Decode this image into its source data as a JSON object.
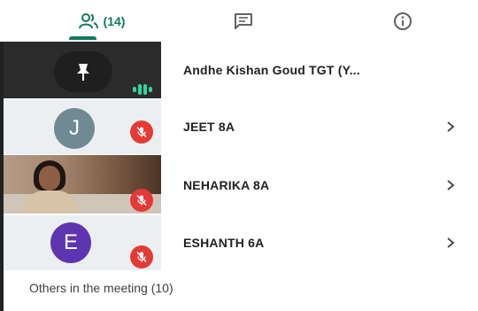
{
  "tabs": {
    "people": {
      "icon": "people-icon",
      "count": "(14)",
      "active": true
    },
    "chat": {
      "icon": "chat-icon"
    },
    "info": {
      "icon": "info-icon"
    }
  },
  "accent_color": "#0f7a5f",
  "participants": [
    {
      "name": "Andhe Kishan Goud TGT (Y...",
      "avatar_icon": "pin-icon",
      "status_icon": "speaking-indicator-icon",
      "avatar_color": "#1f1f1f"
    },
    {
      "name": "JEET 8A",
      "avatar_letter": "J",
      "status_icon": "mic-off-icon",
      "avatar_color": "#6f8a92"
    },
    {
      "name": "NEHARIKA 8A",
      "avatar_icon": "video-feed",
      "status_icon": "mic-off-icon"
    },
    {
      "name": "ESHANTH 6A",
      "avatar_letter": "E",
      "status_icon": "mic-off-icon",
      "avatar_color": "#5e35b1"
    }
  ],
  "others_section": {
    "label": "Others in the meeting (10)"
  }
}
